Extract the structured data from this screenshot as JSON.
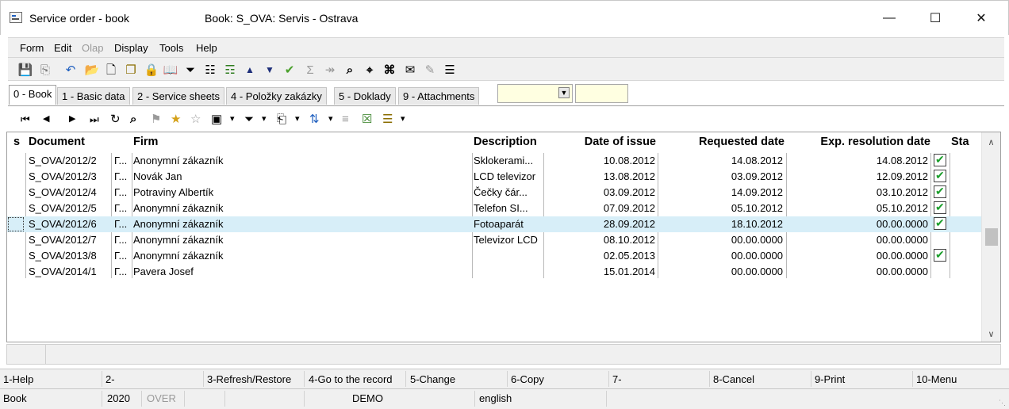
{
  "window": {
    "title": "Service order - book",
    "subtitle": "Book: S_OVA: Servis - Ostrava",
    "minimize_icon": "minimize-icon",
    "maximize_icon": "maximize-icon",
    "close_icon": "close-icon",
    "minimize_glyph": "—",
    "maximize_glyph": "☐",
    "close_glyph": "✕"
  },
  "menu": {
    "items": [
      {
        "label": "Form",
        "disabled": false
      },
      {
        "label": "Edit",
        "disabled": false
      },
      {
        "label": "Olap",
        "disabled": true
      },
      {
        "label": "Display",
        "disabled": false
      },
      {
        "label": "Tools",
        "disabled": false
      },
      {
        "label": "Help",
        "disabled": false
      }
    ]
  },
  "toolbar": {
    "icons": [
      {
        "name": "save-icon",
        "glyph": "💾"
      },
      {
        "name": "save-as-icon",
        "glyph": "⎘"
      },
      {
        "name": "undo-icon",
        "glyph": "↶"
      },
      {
        "name": "open-folder-icon",
        "glyph": "📂"
      },
      {
        "name": "new-document-icon",
        "glyph": "🗋"
      },
      {
        "name": "copy-document-icon",
        "glyph": "❐"
      },
      {
        "name": "lock-icon",
        "glyph": "🔒"
      },
      {
        "name": "book-icon",
        "glyph": "📖"
      },
      {
        "name": "filter-icon",
        "glyph": "⏷"
      },
      {
        "name": "filter-document-icon",
        "glyph": "☷"
      },
      {
        "name": "stack-icon",
        "glyph": "☶"
      },
      {
        "name": "arrow-up-icon",
        "glyph": "▲"
      },
      {
        "name": "arrow-down-icon",
        "glyph": "▼"
      },
      {
        "name": "check-arrow-icon",
        "glyph": "✔"
      },
      {
        "name": "sum-icon",
        "glyph": "Σ"
      },
      {
        "name": "sum-arrow-icon",
        "glyph": "↠"
      },
      {
        "name": "find-icon",
        "glyph": "⌕"
      },
      {
        "name": "find-next-icon",
        "glyph": "⌖"
      },
      {
        "name": "find-replace-icon",
        "glyph": "⌘"
      },
      {
        "name": "mail-icon",
        "glyph": "✉"
      },
      {
        "name": "edit-form-icon",
        "glyph": "✎"
      },
      {
        "name": "hamburger-menu-icon",
        "glyph": "☰"
      }
    ]
  },
  "tabs": [
    {
      "label": "0 - Book",
      "active": true
    },
    {
      "label": "1 - Basic data",
      "active": false
    },
    {
      "label": "2 - Service sheets",
      "active": false
    },
    {
      "label": "4 - Položky zakázky",
      "active": false
    },
    {
      "label": "5 - Doklady",
      "active": false
    },
    {
      "label": "9 - Attachments",
      "active": false
    }
  ],
  "filter": {
    "selected": "",
    "input_value": ""
  },
  "subtoolbar": {
    "icons": [
      {
        "name": "first-record-icon",
        "glyph": "⏮"
      },
      {
        "name": "previous-record-icon",
        "glyph": "◀"
      },
      {
        "name": "next-record-icon",
        "glyph": "▶"
      },
      {
        "name": "last-record-icon",
        "glyph": "⏭"
      },
      {
        "name": "refresh-icon",
        "glyph": "↻"
      },
      {
        "name": "search-icon",
        "glyph": "⌕"
      },
      {
        "name": "bookmark-icon",
        "glyph": "⚑"
      },
      {
        "name": "add-star-icon",
        "glyph": "★"
      },
      {
        "name": "remove-star-icon",
        "glyph": "☆"
      },
      {
        "name": "camera-icon",
        "glyph": "▣"
      },
      {
        "name": "camera-dropdown-icon",
        "glyph": "▾"
      },
      {
        "name": "filter-icon",
        "glyph": "⏷"
      },
      {
        "name": "filter-dropdown-icon",
        "glyph": "▾"
      },
      {
        "name": "export-icon",
        "glyph": "⎗"
      },
      {
        "name": "export-dropdown-icon",
        "glyph": "▾"
      },
      {
        "name": "sort-icon",
        "glyph": "⇅"
      },
      {
        "name": "sort-dropdown-icon",
        "glyph": "▾"
      },
      {
        "name": "tree-icon",
        "glyph": "≡"
      },
      {
        "name": "excel-icon",
        "glyph": "☒"
      },
      {
        "name": "report-icon",
        "glyph": "☰"
      },
      {
        "name": "report-dropdown-icon",
        "glyph": "▾"
      }
    ]
  },
  "table": {
    "columns": {
      "s": "s",
      "document": "Document",
      "flag": "",
      "firm": "Firm",
      "description": "Description",
      "date_issue": "Date of issue",
      "requested_date": "Requested date",
      "exp_resolution_date": "Exp. resolution date",
      "checked": "",
      "status": "Sta"
    },
    "rows": [
      {
        "document": "S_OVA/2012/2",
        "flag": "Г...",
        "firm": "Anonymní zákazník",
        "description": "Sklokerami...",
        "date_issue": "10.08.2012",
        "requested_date": "14.08.2012",
        "exp_resolution_date": "14.08.2012",
        "checked": true,
        "selected": false
      },
      {
        "document": "S_OVA/2012/3",
        "flag": "Г...",
        "firm": "Novák Jan",
        "description": "LCD televizor",
        "date_issue": "13.08.2012",
        "requested_date": "03.09.2012",
        "exp_resolution_date": "12.09.2012",
        "checked": true,
        "selected": false
      },
      {
        "document": "S_OVA/2012/4",
        "flag": "Г...",
        "firm": "Potraviny Albertík",
        "description": "Čečky čár...",
        "date_issue": "03.09.2012",
        "requested_date": "14.09.2012",
        "exp_resolution_date": "03.10.2012",
        "checked": true,
        "selected": false
      },
      {
        "document": "S_OVA/2012/5",
        "flag": "Г...",
        "firm": "Anonymní zákazník",
        "description": "Telefon SI...",
        "date_issue": "07.09.2012",
        "requested_date": "05.10.2012",
        "exp_resolution_date": "05.10.2012",
        "checked": true,
        "selected": false
      },
      {
        "document": "S_OVA/2012/6",
        "flag": "Г...",
        "firm": "Anonymní zákazník",
        "description": "Fotoaparát",
        "date_issue": "28.09.2012",
        "requested_date": "18.10.2012",
        "exp_resolution_date": "00.00.0000",
        "checked": true,
        "selected": true
      },
      {
        "document": "S_OVA/2012/7",
        "flag": "Г...",
        "firm": "Anonymní zákazník",
        "description": "Televizor LCD",
        "date_issue": "08.10.2012",
        "requested_date": "00.00.0000",
        "exp_resolution_date": "00.00.0000",
        "checked": false,
        "selected": false
      },
      {
        "document": "S_OVA/2013/8",
        "flag": "Г...",
        "firm": "Anonymní zákazník",
        "description": "",
        "date_issue": "02.05.2013",
        "requested_date": "00.00.0000",
        "exp_resolution_date": "00.00.0000",
        "checked": true,
        "selected": false
      },
      {
        "document": "S_OVA/2014/1",
        "flag": "Г...",
        "firm": "Pavera Josef",
        "description": "",
        "date_issue": "15.01.2014",
        "requested_date": "00.00.0000",
        "exp_resolution_date": "00.00.0000",
        "checked": false,
        "selected": false
      }
    ],
    "selected_row_color": "#d7eef8"
  },
  "scrollbar": {
    "up_icon": "scroll-up-icon",
    "down_icon": "scroll-down-icon",
    "up_glyph": "∧",
    "down_glyph": "∨"
  },
  "fkeys": [
    "1-Help",
    "2-",
    "3-Refresh/Restore",
    "4-Go to the record",
    "5-Change",
    "6-Copy",
    "7-",
    "8-Cancel",
    "9-Print",
    "10-Menu"
  ],
  "statusbar": {
    "mode": "Book",
    "year": "2020",
    "over": "OVER",
    "database": "DEMO",
    "language": "english"
  }
}
